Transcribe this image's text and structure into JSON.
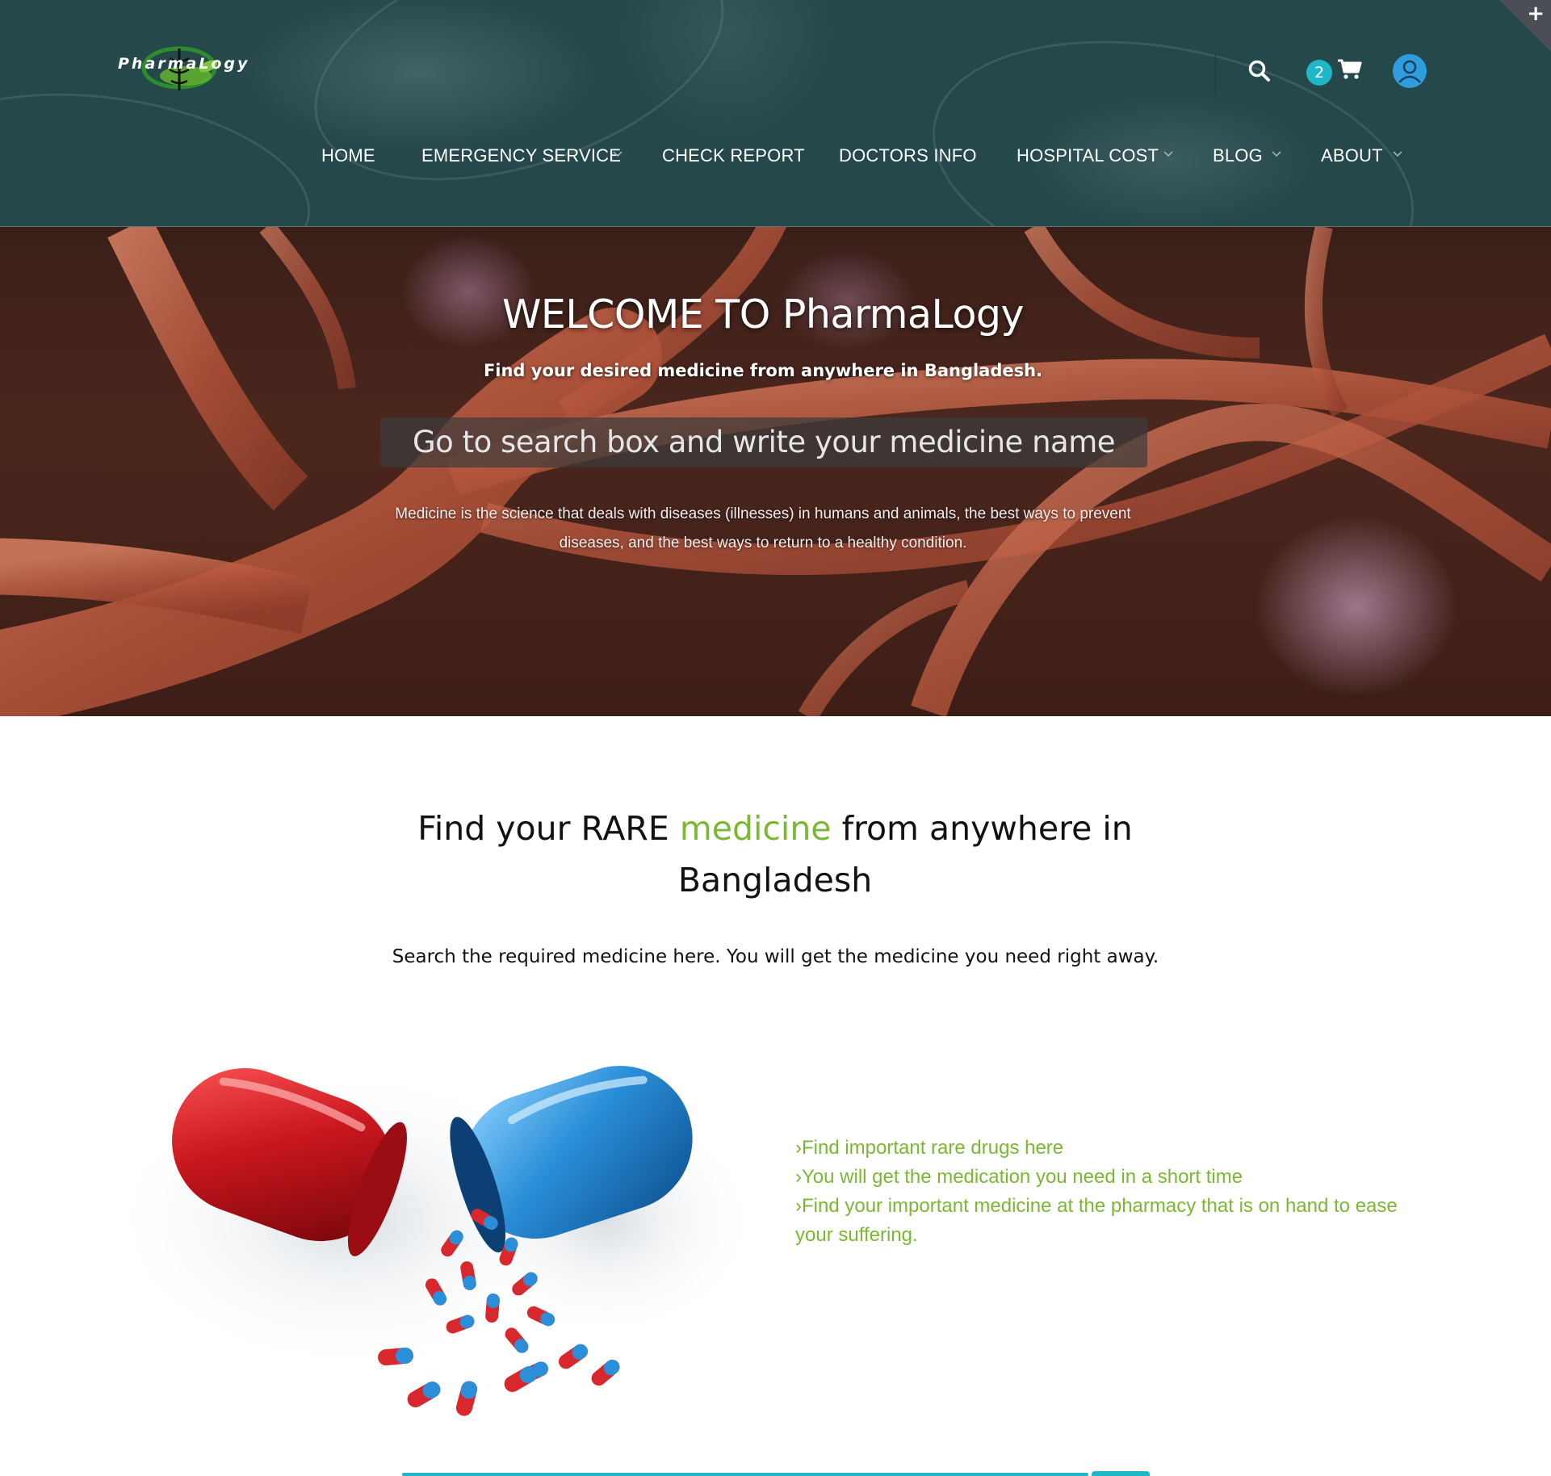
{
  "brand": {
    "logo_text": "PharmaLogy"
  },
  "header": {
    "cart_count": "2",
    "nav": [
      {
        "label": "HOME",
        "dropdown": false
      },
      {
        "label": "EMERGENCY SERVICE",
        "dropdown": true
      },
      {
        "label": "CHECK REPORT",
        "dropdown": false
      },
      {
        "label": "DOCTORS INFO",
        "dropdown": false
      },
      {
        "label": "HOSPITAL COST",
        "dropdown": true
      },
      {
        "label": "BLOG",
        "dropdown": true
      },
      {
        "label": "ABOUT",
        "dropdown": true
      }
    ]
  },
  "hero": {
    "title": "WELCOME TO PharmaLogy",
    "subtitle": "Find your desired medicine from anywhere in Bangladesh.",
    "search_prompt": "Go to search box and write your medicine name",
    "description": "Medicine is the science that deals with diseases (illnesses) in humans and animals, the best ways to prevent diseases, and the best ways to return to a healthy condition."
  },
  "section": {
    "title_part1": "Find your RARE ",
    "title_highlight": "medicine",
    "title_part2": " from anywhere in Bangladesh",
    "subtitle": "Search the required medicine here. You will get the medicine you need right away.",
    "features": [
      "›Find important rare drugs here",
      "›You will get the medication you need in a short time",
      "›Find your important medicine at the pharmacy that is on hand to ease your suffering."
    ]
  },
  "colors": {
    "header_bg": "#25484a",
    "accent_green": "#7bb832",
    "accent_cyan": "#1fb7c7",
    "capsule_red": "#c8161d",
    "capsule_blue": "#2a8fd8"
  },
  "icons": [
    "search-icon",
    "cart-icon",
    "user-icon",
    "chevron-down-icon",
    "plus-icon"
  ]
}
